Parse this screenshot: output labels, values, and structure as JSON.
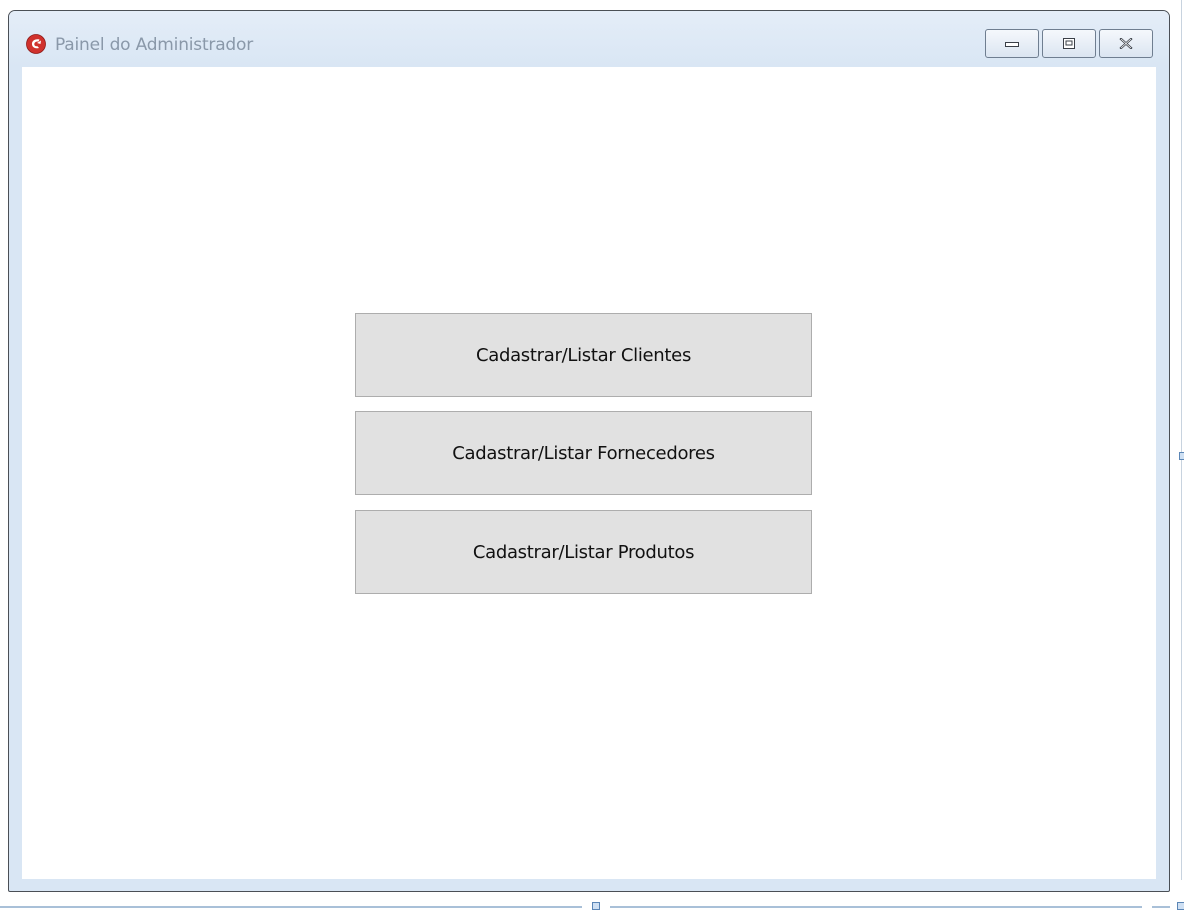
{
  "window": {
    "title": "Painel do Administrador",
    "icon": "red-round-app-icon",
    "caption_buttons": [
      {
        "name": "minimize",
        "icon": "minimize-icon"
      },
      {
        "name": "maximize",
        "icon": "maximize-icon"
      },
      {
        "name": "close",
        "icon": "close-icon"
      }
    ]
  },
  "main": {
    "buttons": [
      {
        "label": "Cadastrar/Listar Clientes"
      },
      {
        "label": "Cadastrar/Listar Fornecedores"
      },
      {
        "label": "Cadastrar/Listar Produtos"
      }
    ]
  },
  "colors": {
    "frame": "#d9e6f4",
    "button_face": "#e1e1e1",
    "button_border": "#adadad",
    "title_text": "#8a98a9",
    "icon_red": "#d0312d"
  }
}
